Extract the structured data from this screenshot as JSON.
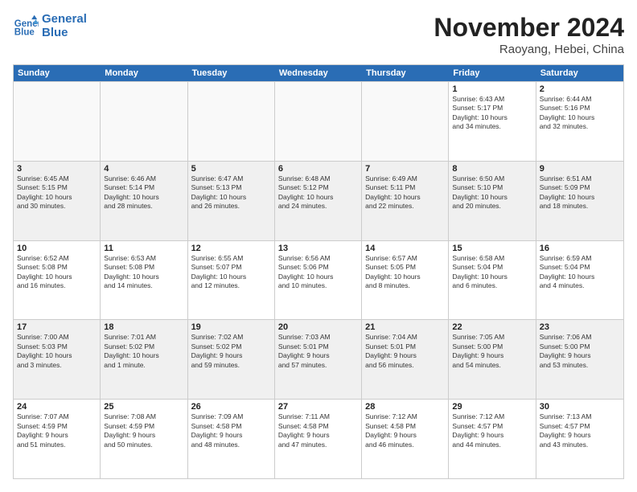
{
  "logo": {
    "line1": "General",
    "line2": "Blue"
  },
  "title": "November 2024",
  "location": "Raoyang, Hebei, China",
  "days_of_week": [
    "Sunday",
    "Monday",
    "Tuesday",
    "Wednesday",
    "Thursday",
    "Friday",
    "Saturday"
  ],
  "weeks": [
    [
      {
        "day": "",
        "info": ""
      },
      {
        "day": "",
        "info": ""
      },
      {
        "day": "",
        "info": ""
      },
      {
        "day": "",
        "info": ""
      },
      {
        "day": "",
        "info": ""
      },
      {
        "day": "1",
        "info": "Sunrise: 6:43 AM\nSunset: 5:17 PM\nDaylight: 10 hours\nand 34 minutes."
      },
      {
        "day": "2",
        "info": "Sunrise: 6:44 AM\nSunset: 5:16 PM\nDaylight: 10 hours\nand 32 minutes."
      }
    ],
    [
      {
        "day": "3",
        "info": "Sunrise: 6:45 AM\nSunset: 5:15 PM\nDaylight: 10 hours\nand 30 minutes."
      },
      {
        "day": "4",
        "info": "Sunrise: 6:46 AM\nSunset: 5:14 PM\nDaylight: 10 hours\nand 28 minutes."
      },
      {
        "day": "5",
        "info": "Sunrise: 6:47 AM\nSunset: 5:13 PM\nDaylight: 10 hours\nand 26 minutes."
      },
      {
        "day": "6",
        "info": "Sunrise: 6:48 AM\nSunset: 5:12 PM\nDaylight: 10 hours\nand 24 minutes."
      },
      {
        "day": "7",
        "info": "Sunrise: 6:49 AM\nSunset: 5:11 PM\nDaylight: 10 hours\nand 22 minutes."
      },
      {
        "day": "8",
        "info": "Sunrise: 6:50 AM\nSunset: 5:10 PM\nDaylight: 10 hours\nand 20 minutes."
      },
      {
        "day": "9",
        "info": "Sunrise: 6:51 AM\nSunset: 5:09 PM\nDaylight: 10 hours\nand 18 minutes."
      }
    ],
    [
      {
        "day": "10",
        "info": "Sunrise: 6:52 AM\nSunset: 5:08 PM\nDaylight: 10 hours\nand 16 minutes."
      },
      {
        "day": "11",
        "info": "Sunrise: 6:53 AM\nSunset: 5:08 PM\nDaylight: 10 hours\nand 14 minutes."
      },
      {
        "day": "12",
        "info": "Sunrise: 6:55 AM\nSunset: 5:07 PM\nDaylight: 10 hours\nand 12 minutes."
      },
      {
        "day": "13",
        "info": "Sunrise: 6:56 AM\nSunset: 5:06 PM\nDaylight: 10 hours\nand 10 minutes."
      },
      {
        "day": "14",
        "info": "Sunrise: 6:57 AM\nSunset: 5:05 PM\nDaylight: 10 hours\nand 8 minutes."
      },
      {
        "day": "15",
        "info": "Sunrise: 6:58 AM\nSunset: 5:04 PM\nDaylight: 10 hours\nand 6 minutes."
      },
      {
        "day": "16",
        "info": "Sunrise: 6:59 AM\nSunset: 5:04 PM\nDaylight: 10 hours\nand 4 minutes."
      }
    ],
    [
      {
        "day": "17",
        "info": "Sunrise: 7:00 AM\nSunset: 5:03 PM\nDaylight: 10 hours\nand 3 minutes."
      },
      {
        "day": "18",
        "info": "Sunrise: 7:01 AM\nSunset: 5:02 PM\nDaylight: 10 hours\nand 1 minute."
      },
      {
        "day": "19",
        "info": "Sunrise: 7:02 AM\nSunset: 5:02 PM\nDaylight: 9 hours\nand 59 minutes."
      },
      {
        "day": "20",
        "info": "Sunrise: 7:03 AM\nSunset: 5:01 PM\nDaylight: 9 hours\nand 57 minutes."
      },
      {
        "day": "21",
        "info": "Sunrise: 7:04 AM\nSunset: 5:01 PM\nDaylight: 9 hours\nand 56 minutes."
      },
      {
        "day": "22",
        "info": "Sunrise: 7:05 AM\nSunset: 5:00 PM\nDaylight: 9 hours\nand 54 minutes."
      },
      {
        "day": "23",
        "info": "Sunrise: 7:06 AM\nSunset: 5:00 PM\nDaylight: 9 hours\nand 53 minutes."
      }
    ],
    [
      {
        "day": "24",
        "info": "Sunrise: 7:07 AM\nSunset: 4:59 PM\nDaylight: 9 hours\nand 51 minutes."
      },
      {
        "day": "25",
        "info": "Sunrise: 7:08 AM\nSunset: 4:59 PM\nDaylight: 9 hours\nand 50 minutes."
      },
      {
        "day": "26",
        "info": "Sunrise: 7:09 AM\nSunset: 4:58 PM\nDaylight: 9 hours\nand 48 minutes."
      },
      {
        "day": "27",
        "info": "Sunrise: 7:11 AM\nSunset: 4:58 PM\nDaylight: 9 hours\nand 47 minutes."
      },
      {
        "day": "28",
        "info": "Sunrise: 7:12 AM\nSunset: 4:58 PM\nDaylight: 9 hours\nand 46 minutes."
      },
      {
        "day": "29",
        "info": "Sunrise: 7:12 AM\nSunset: 4:57 PM\nDaylight: 9 hours\nand 44 minutes."
      },
      {
        "day": "30",
        "info": "Sunrise: 7:13 AM\nSunset: 4:57 PM\nDaylight: 9 hours\nand 43 minutes."
      }
    ]
  ]
}
